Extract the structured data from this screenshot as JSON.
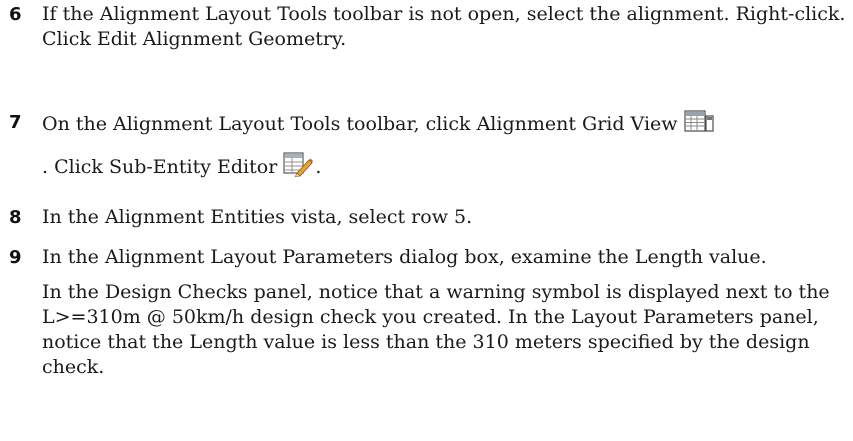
{
  "steps": [
    {
      "number": "6",
      "text": "If the Alignment Layout Tools toolbar is not open, select the alignment. Right-click. Click Edit Alignment Geometry."
    },
    {
      "number": "7",
      "text_before_icon1": "On the Alignment Layout Tools toolbar, click Alignment Grid View",
      "icon1": "grid-view-icon",
      "text_before_icon2": ". Click Sub-Entity Editor",
      "icon2": "sub-entity-editor-icon",
      "text_after_icon2": "."
    },
    {
      "number": "8",
      "text": "In the Alignment Entities vista, select row 5."
    },
    {
      "number": "9",
      "text": "In the Alignment Layout Parameters dialog box, examine the Length value.",
      "note": "In the Design Checks panel, notice that a warning symbol is displayed next to the L>=310m @ 50km/h design check you created. In the Layout Parameters panel, notice that the Length value is less than the 310 meters specified by the design check."
    }
  ],
  "colors": {
    "text": "#1a1a1a",
    "icon_grid_border": "#4d4d4d",
    "icon_pencil": "#e8a33a"
  }
}
